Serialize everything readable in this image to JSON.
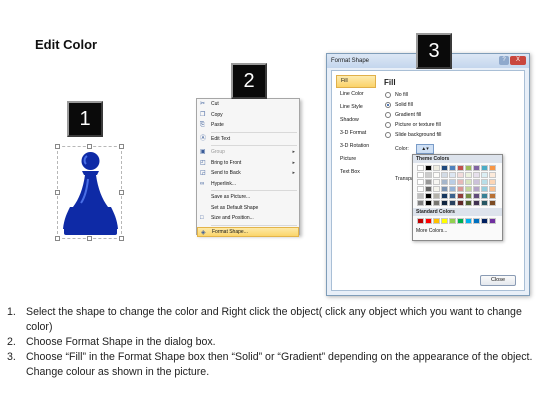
{
  "slide": {
    "title": "Edit Color"
  },
  "badges": [
    "1",
    "2",
    "3"
  ],
  "pawn": {
    "fill": "#0e2aa6",
    "highlight": "#4a6fe6"
  },
  "context_menu": {
    "items": [
      {
        "label": "Cut",
        "icon": "scissors-icon",
        "disabled": false,
        "submenu": false
      },
      {
        "label": "Copy",
        "icon": "copy-icon",
        "disabled": false,
        "submenu": false
      },
      {
        "label": "Paste",
        "icon": "paste-icon",
        "disabled": false,
        "submenu": false
      },
      {
        "label": "Edit Text",
        "icon": "text-icon",
        "disabled": false,
        "submenu": false
      },
      {
        "label": "Group",
        "icon": "group-icon",
        "disabled": true,
        "submenu": true
      },
      {
        "label": "Bring to Front",
        "icon": "bring-front-icon",
        "disabled": false,
        "submenu": true
      },
      {
        "label": "Send to Back",
        "icon": "send-back-icon",
        "disabled": false,
        "submenu": true
      },
      {
        "label": "Hyperlink...",
        "icon": "hyperlink-icon",
        "disabled": false,
        "submenu": false
      },
      {
        "label": "Save as Picture...",
        "icon": "",
        "disabled": false,
        "submenu": false
      },
      {
        "label": "Set as Default Shape",
        "icon": "",
        "disabled": false,
        "submenu": false
      },
      {
        "label": "Size and Position...",
        "icon": "size-icon",
        "disabled": false,
        "submenu": false
      },
      {
        "label": "Format Shape...",
        "icon": "format-shape-icon",
        "disabled": false,
        "submenu": false,
        "highlighted": true
      }
    ]
  },
  "dialog": {
    "title": "Format Shape",
    "help": "?",
    "close_x": "X",
    "nav": [
      "Fill",
      "Line Color",
      "Line Style",
      "Shadow",
      "3-D Format",
      "3-D Rotation",
      "Picture",
      "Text Box"
    ],
    "active_nav": "Fill",
    "pane_title": "Fill",
    "options": [
      {
        "label": "No fill",
        "selected": false
      },
      {
        "label": "Solid fill",
        "selected": true
      },
      {
        "label": "Gradient fill",
        "selected": false
      },
      {
        "label": "Picture or texture fill",
        "selected": false
      },
      {
        "label": "Slide background fill",
        "selected": false
      }
    ],
    "color_label": "Color:",
    "transparency_label": "Transpar",
    "close_button": "Close",
    "palette": {
      "theme_heading": "Theme Colors",
      "standard_heading": "Standard Colors",
      "more": "More Colors...",
      "theme_top": [
        "#ffffff",
        "#000000",
        "#eeece1",
        "#1f497d",
        "#4f81bd",
        "#c0504d",
        "#9bbb59",
        "#8064a2",
        "#4bacc6",
        "#f79646"
      ],
      "standard": [
        "#c00000",
        "#ff0000",
        "#ffc000",
        "#ffff00",
        "#92d050",
        "#00b050",
        "#00b0f0",
        "#0070c0",
        "#002060",
        "#7030a0"
      ]
    }
  },
  "instructions": [
    {
      "num": "1.",
      "text": "Select the shape to change the color and Right click the object( click any object which you want to change color)"
    },
    {
      "num": "2.",
      "text": "Choose Format Shape in the dialog box."
    },
    {
      "num": "3.",
      "text": "Choose “Fill” in the Format Shape box then “Solid” or “Gradient” depending on the appearance of the object. Change colour as shown in the picture."
    }
  ]
}
